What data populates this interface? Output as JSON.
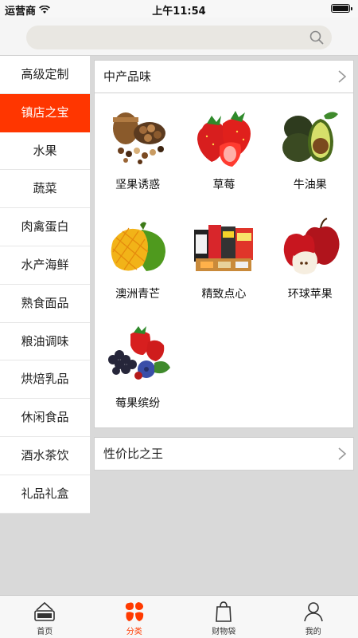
{
  "status_bar": {
    "carrier": "运营商",
    "time": "上午11:54"
  },
  "search": {
    "placeholder": ""
  },
  "sidebar": {
    "items": [
      {
        "label": "高级定制"
      },
      {
        "label": "镇店之宝"
      },
      {
        "label": "水果"
      },
      {
        "label": "蔬菜"
      },
      {
        "label": "肉禽蛋白"
      },
      {
        "label": "水产海鲜"
      },
      {
        "label": "熟食面品"
      },
      {
        "label": "粮油调味"
      },
      {
        "label": "烘焙乳品"
      },
      {
        "label": "休闲食品"
      },
      {
        "label": "酒水茶饮"
      },
      {
        "label": "礼品礼盒"
      }
    ],
    "active_index": 1
  },
  "sections": [
    {
      "title": "中产品味",
      "products": [
        {
          "label": "坚果诱惑",
          "icon": "nuts-icon"
        },
        {
          "label": "草莓",
          "icon": "strawberry-icon"
        },
        {
          "label": "牛油果",
          "icon": "avocado-icon"
        },
        {
          "label": "澳洲青芒",
          "icon": "mango-icon"
        },
        {
          "label": "精致点心",
          "icon": "snacks-icon"
        },
        {
          "label": "环球苹果",
          "icon": "apple-icon"
        },
        {
          "label": "莓果缤纷",
          "icon": "berries-icon"
        }
      ]
    },
    {
      "title": "性价比之王"
    }
  ],
  "tabbar": {
    "items": [
      {
        "label": "首页",
        "icon": "home-icon"
      },
      {
        "label": "分类",
        "icon": "category-icon"
      },
      {
        "label": "财物袋",
        "icon": "bag-icon"
      },
      {
        "label": "我的",
        "icon": "user-icon"
      }
    ],
    "active_index": 1
  },
  "colors": {
    "accent": "#ff3600",
    "background": "#d9d9d9"
  }
}
